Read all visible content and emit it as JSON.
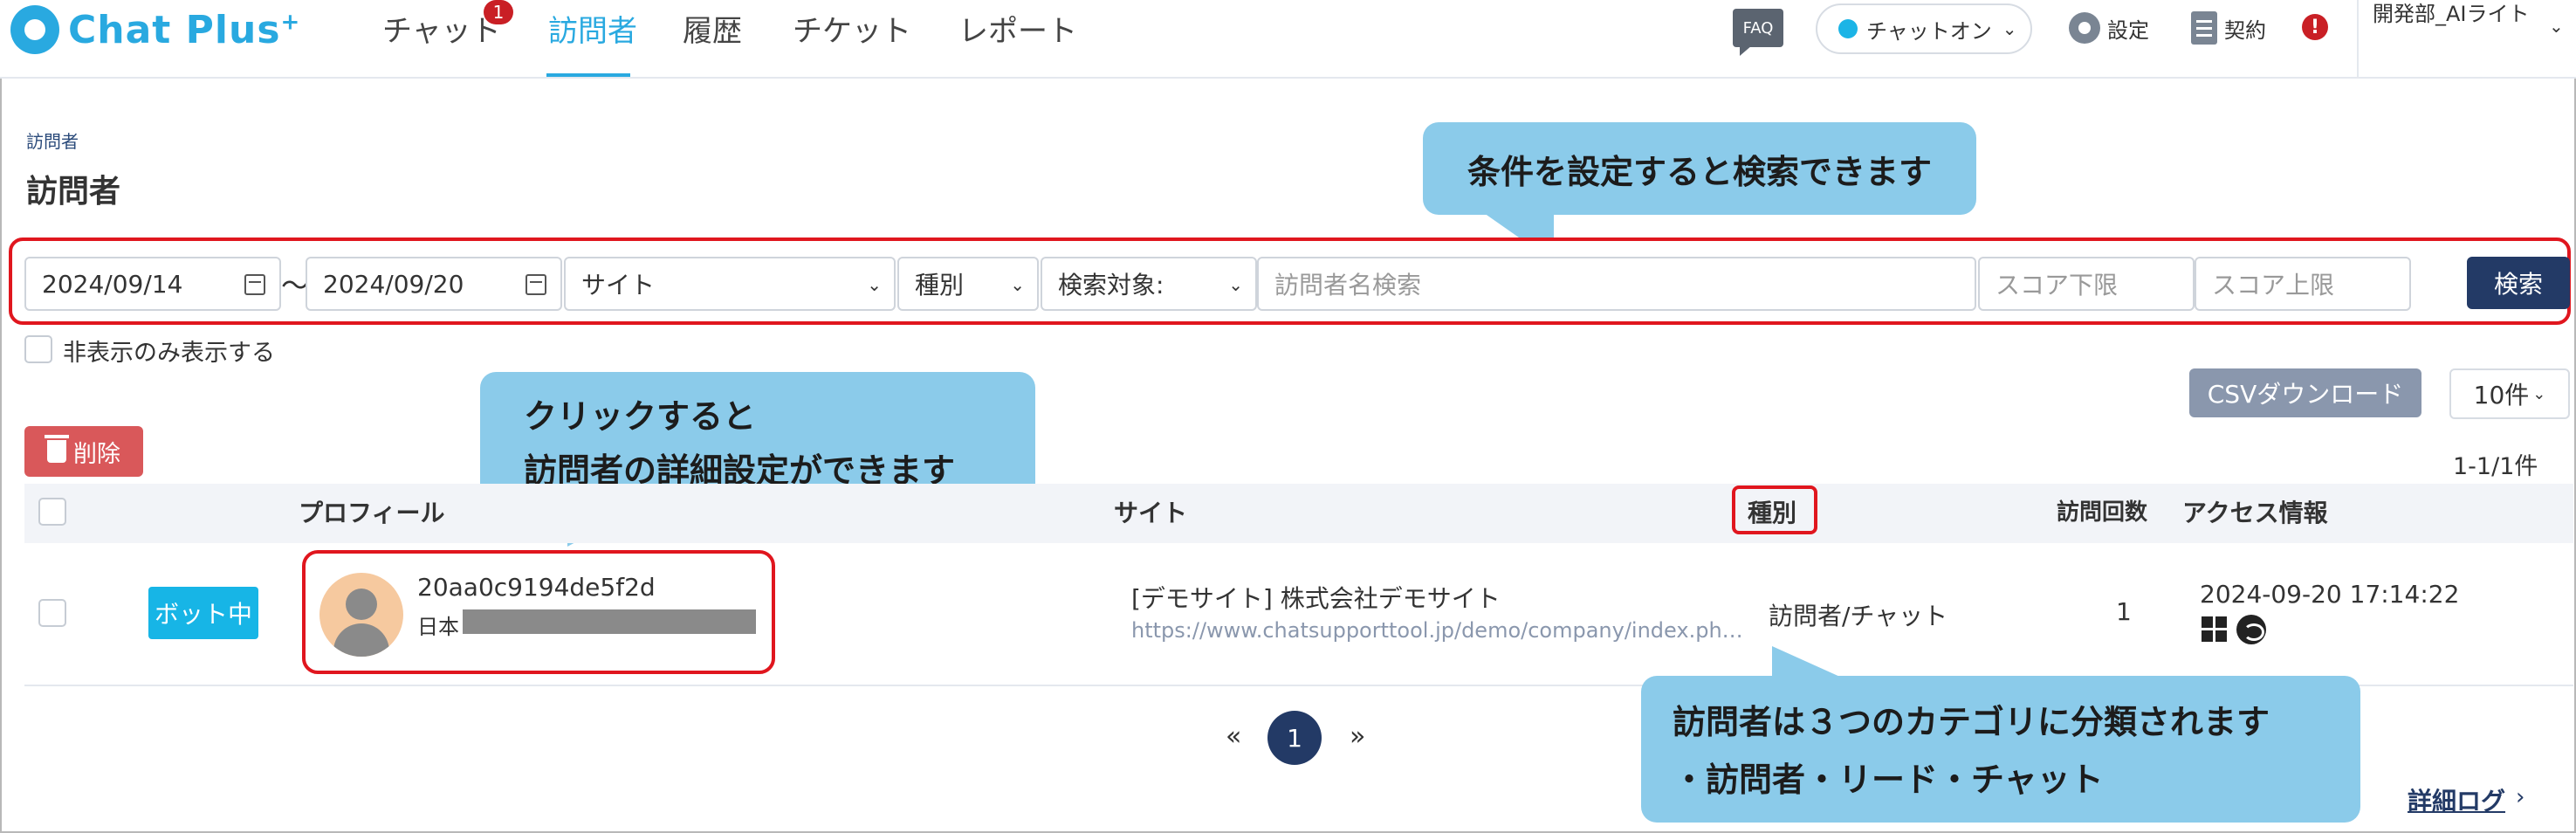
{
  "header": {
    "logo_text": "Chat Plus",
    "logo_plus": "+",
    "nav": [
      {
        "label": "チャット"
      },
      {
        "label": "訪問者"
      },
      {
        "label": "履歴"
      },
      {
        "label": "チケット"
      },
      {
        "label": "レポート"
      }
    ],
    "chat_badge": "1",
    "faq": "FAQ",
    "chat_status": "チャットオン",
    "settings": "設定",
    "contract": "契約",
    "alert": "!",
    "user_name": "開発部_AIライト"
  },
  "page": {
    "breadcrumb": "訪問者",
    "title": "訪問者"
  },
  "callouts": {
    "search": "条件を設定すると検索できます",
    "profile_line1": "クリックすると",
    "profile_line2": "訪問者の詳細設定ができます",
    "type_line1": "訪問者は３つのカテゴリに分類されます",
    "type_line2": "・訪問者・リード・チャット"
  },
  "filters": {
    "date_from": "2024/09/14",
    "tilde": "～",
    "date_to": "2024/09/20",
    "site": "サイト",
    "type": "種別",
    "target": "検索対象:",
    "name_placeholder": "訪問者名検索",
    "score_min_placeholder": "スコア下限",
    "score_max_placeholder": "スコア上限",
    "search_button": "検索",
    "hidden_only": "非表示のみ表示する"
  },
  "toolbar": {
    "csv": "CSVダウンロード",
    "per_page": "10件",
    "delete": "削除",
    "count": "1-1/1件"
  },
  "table": {
    "headers": {
      "profile": "プロフィール",
      "site": "サイト",
      "type": "種別",
      "visits": "訪問回数",
      "access": "アクセス情報"
    },
    "rows": [
      {
        "status": "ボット中",
        "visitor_id": "20aa0c9194de5f2d",
        "country": "日本",
        "site_name": "[デモサイト] 株式会社デモサイト",
        "site_url": "https://www.chatsupporttool.jp/demo/company/index.ph…",
        "type": "訪問者/チャット",
        "visits": "1",
        "access_time": "2024-09-20 17:14:22"
      }
    ]
  },
  "pagination": {
    "prev": "«",
    "current": "1",
    "next": "»"
  },
  "footer": {
    "detail_log": "詳細ログ",
    "detail_arrow": "›"
  }
}
